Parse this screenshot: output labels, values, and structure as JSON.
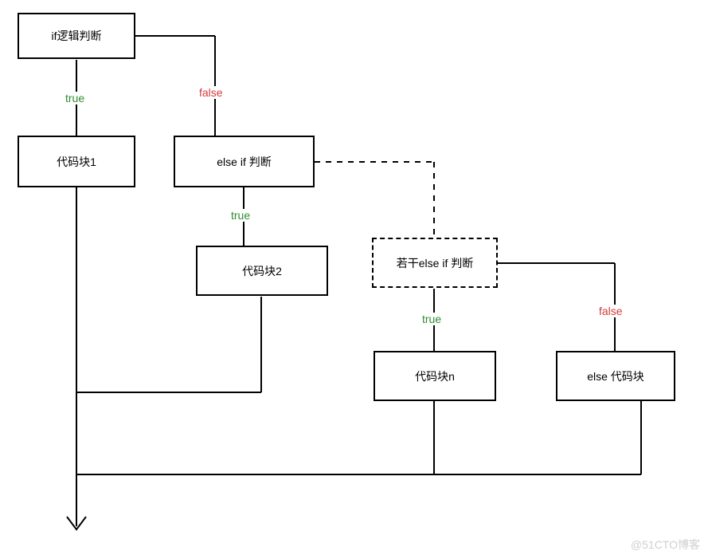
{
  "nodes": {
    "if_check": "if逻辑判断",
    "block1": "代码块1",
    "elseif": "else if 判断",
    "block2": "代码块2",
    "n_elseif": "若干else if 判断",
    "block_n": "代码块n",
    "else_block": "else 代码块"
  },
  "edges": {
    "true": "true",
    "false": "false"
  },
  "watermark": "@51CTO博客",
  "chart_data": {
    "type": "flowchart",
    "title": "",
    "nodes": [
      {
        "id": "if_check",
        "label": "if逻辑判断",
        "style": "solid"
      },
      {
        "id": "block1",
        "label": "代码块1",
        "style": "solid"
      },
      {
        "id": "elseif",
        "label": "else if 判断",
        "style": "solid"
      },
      {
        "id": "block2",
        "label": "代码块2",
        "style": "solid"
      },
      {
        "id": "n_elseif",
        "label": "若干else if 判断",
        "style": "dashed"
      },
      {
        "id": "block_n",
        "label": "代码块n",
        "style": "solid"
      },
      {
        "id": "else_block",
        "label": "else 代码块",
        "style": "solid"
      },
      {
        "id": "exit",
        "label": "",
        "style": "arrow"
      }
    ],
    "edges": [
      {
        "from": "if_check",
        "to": "block1",
        "label": "true"
      },
      {
        "from": "if_check",
        "to": "elseif",
        "label": "false"
      },
      {
        "from": "elseif",
        "to": "block2",
        "label": "true"
      },
      {
        "from": "elseif",
        "to": "n_elseif",
        "label": "",
        "style": "dashed"
      },
      {
        "from": "n_elseif",
        "to": "block_n",
        "label": "true"
      },
      {
        "from": "n_elseif",
        "to": "else_block",
        "label": "false"
      },
      {
        "from": "block1",
        "to": "exit",
        "label": ""
      },
      {
        "from": "block2",
        "to": "exit",
        "label": ""
      },
      {
        "from": "block_n",
        "to": "exit",
        "label": ""
      },
      {
        "from": "else_block",
        "to": "exit",
        "label": ""
      }
    ]
  }
}
